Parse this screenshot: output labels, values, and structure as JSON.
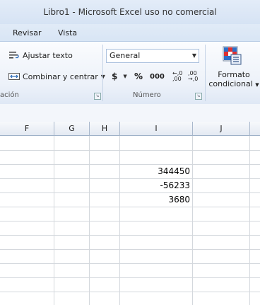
{
  "window": {
    "title": "Libro1 - Microsoft Excel uso no comercial"
  },
  "tabs": [
    "Revisar",
    "Vista"
  ],
  "ribbon": {
    "alignment": {
      "wrap_text": "Ajustar texto",
      "merge_center": "Combinar y centrar",
      "group_label": "ación"
    },
    "number": {
      "format_value": "General",
      "currency_symbol": "$",
      "percent_symbol": "%",
      "thousands_label": "000",
      "increase_decimal": "←,0 ,00",
      "decrease_decimal": ",00 →,0",
      "group_label": "Número"
    },
    "styles": {
      "conditional_format_line1": "Formato",
      "conditional_format_line2": "condicional"
    }
  },
  "columns": [
    "F",
    "G",
    "H",
    "I",
    "J"
  ],
  "cells": [
    {
      "col": "I",
      "row_index": 2,
      "value": "344450"
    },
    {
      "col": "I",
      "row_index": 3,
      "value": "-56233"
    },
    {
      "col": "I",
      "row_index": 4,
      "value": "3680"
    }
  ],
  "colors": {
    "ribbon_bg": "#ecf1f9",
    "title_bar": "#dbe6f4",
    "grid_line": "#d4d8dd",
    "header_bg": "#e3e9f2"
  }
}
